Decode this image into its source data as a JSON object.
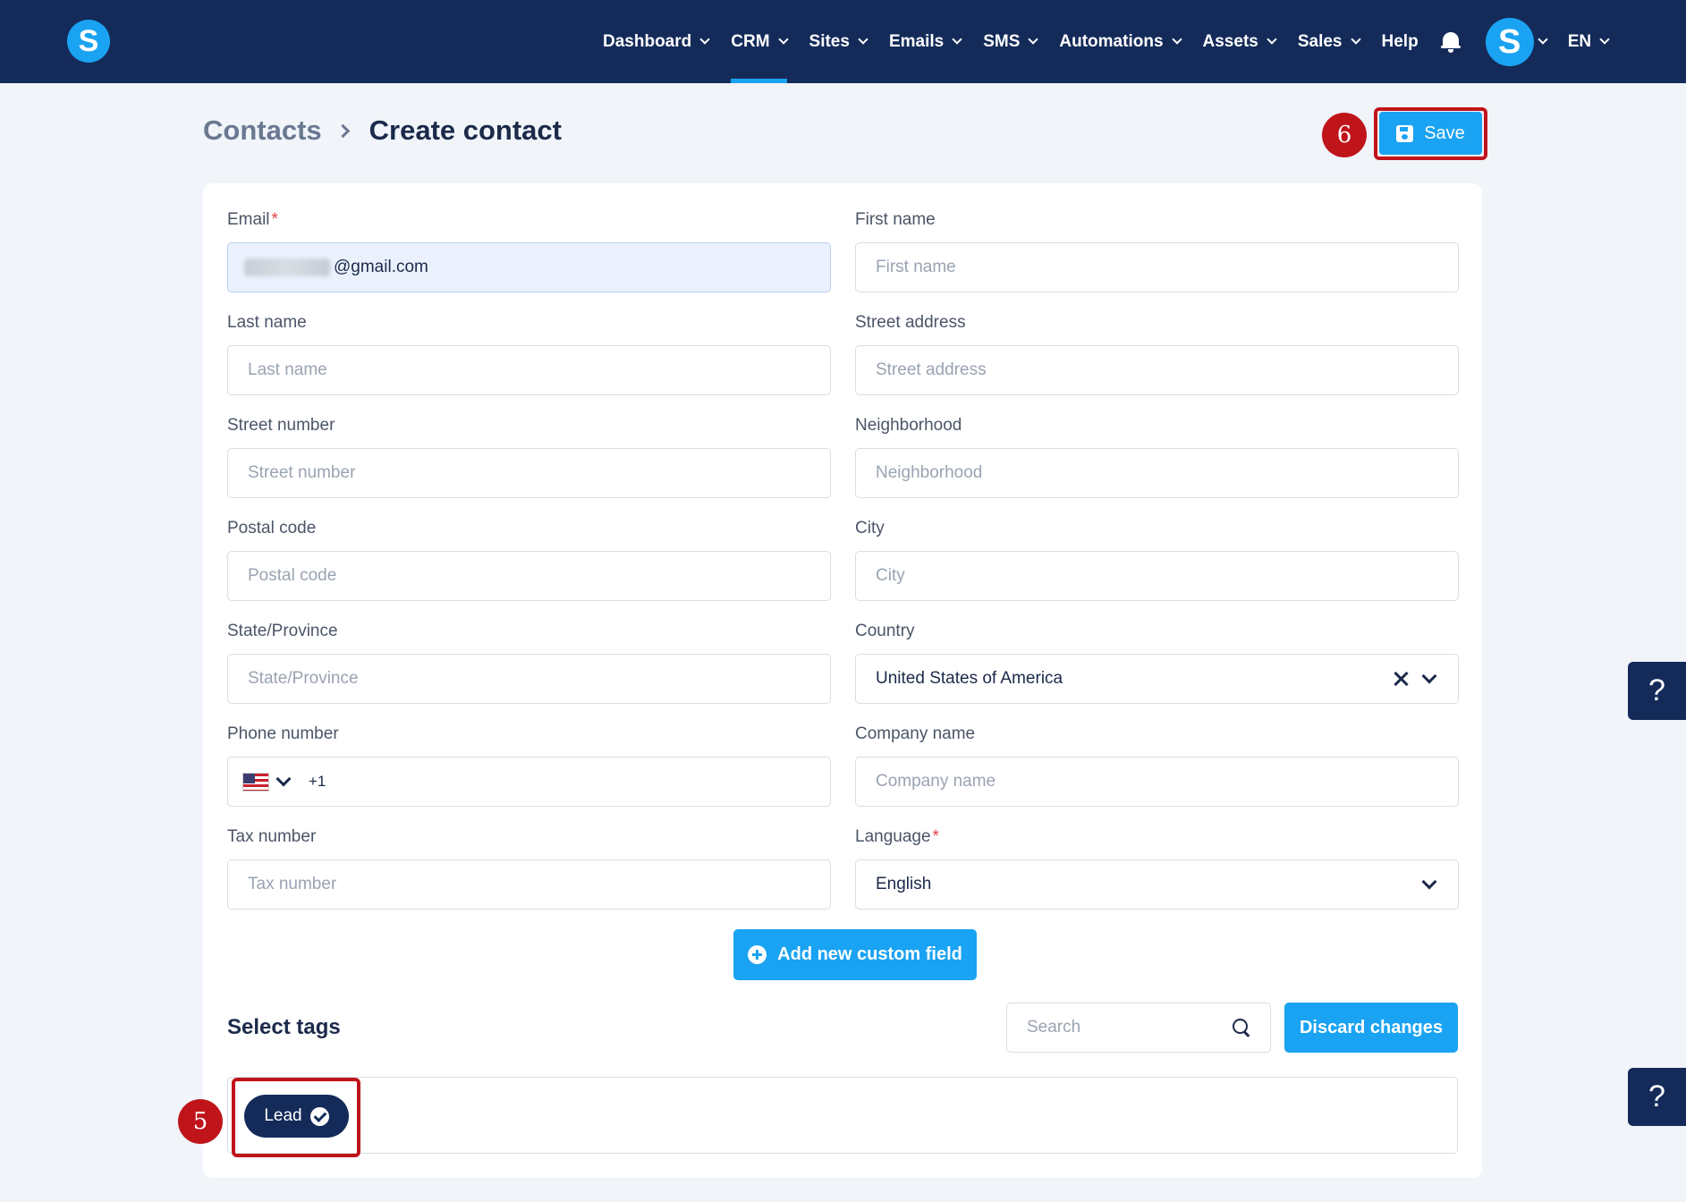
{
  "nav": {
    "logo": "S",
    "items": [
      {
        "label": "Dashboard"
      },
      {
        "label": "CRM"
      },
      {
        "label": "Sites"
      },
      {
        "label": "Emails"
      },
      {
        "label": "SMS"
      },
      {
        "label": "Automations"
      },
      {
        "label": "Assets"
      },
      {
        "label": "Sales"
      },
      {
        "label": "Help"
      }
    ],
    "active": "CRM",
    "avatar": "S",
    "language": "EN"
  },
  "breadcrumb": {
    "parent": "Contacts",
    "current": "Create contact"
  },
  "save_label": "Save",
  "steps": {
    "save": "6",
    "tag": "5"
  },
  "fields": {
    "email": {
      "label": "Email",
      "value": "@gmail.com"
    },
    "first_name": {
      "label": "First name",
      "placeholder": "First name"
    },
    "last_name": {
      "label": "Last name",
      "placeholder": "Last name"
    },
    "street_address": {
      "label": "Street address",
      "placeholder": "Street address"
    },
    "street_number": {
      "label": "Street number",
      "placeholder": "Street number"
    },
    "neighborhood": {
      "label": "Neighborhood",
      "placeholder": "Neighborhood"
    },
    "postal_code": {
      "label": "Postal code",
      "placeholder": "Postal code"
    },
    "city": {
      "label": "City",
      "placeholder": "City"
    },
    "state": {
      "label": "State/Province",
      "placeholder": "State/Province"
    },
    "country": {
      "label": "Country",
      "value": "United States of America"
    },
    "phone": {
      "label": "Phone number",
      "dial_code": "+1"
    },
    "company": {
      "label": "Company name",
      "placeholder": "Company name"
    },
    "tax": {
      "label": "Tax number",
      "placeholder": "Tax number"
    },
    "language": {
      "label": "Language",
      "value": "English"
    }
  },
  "required_mark": "*",
  "add_field_label": "Add new custom field",
  "tags": {
    "title": "Select tags",
    "search_placeholder": "Search",
    "discard_label": "Discard changes",
    "items": [
      {
        "label": "Lead"
      }
    ]
  },
  "help_label": "?",
  "colors": {
    "navy": "#142b5a",
    "accent": "#1aa3f2",
    "annotation": "#c0141b"
  }
}
